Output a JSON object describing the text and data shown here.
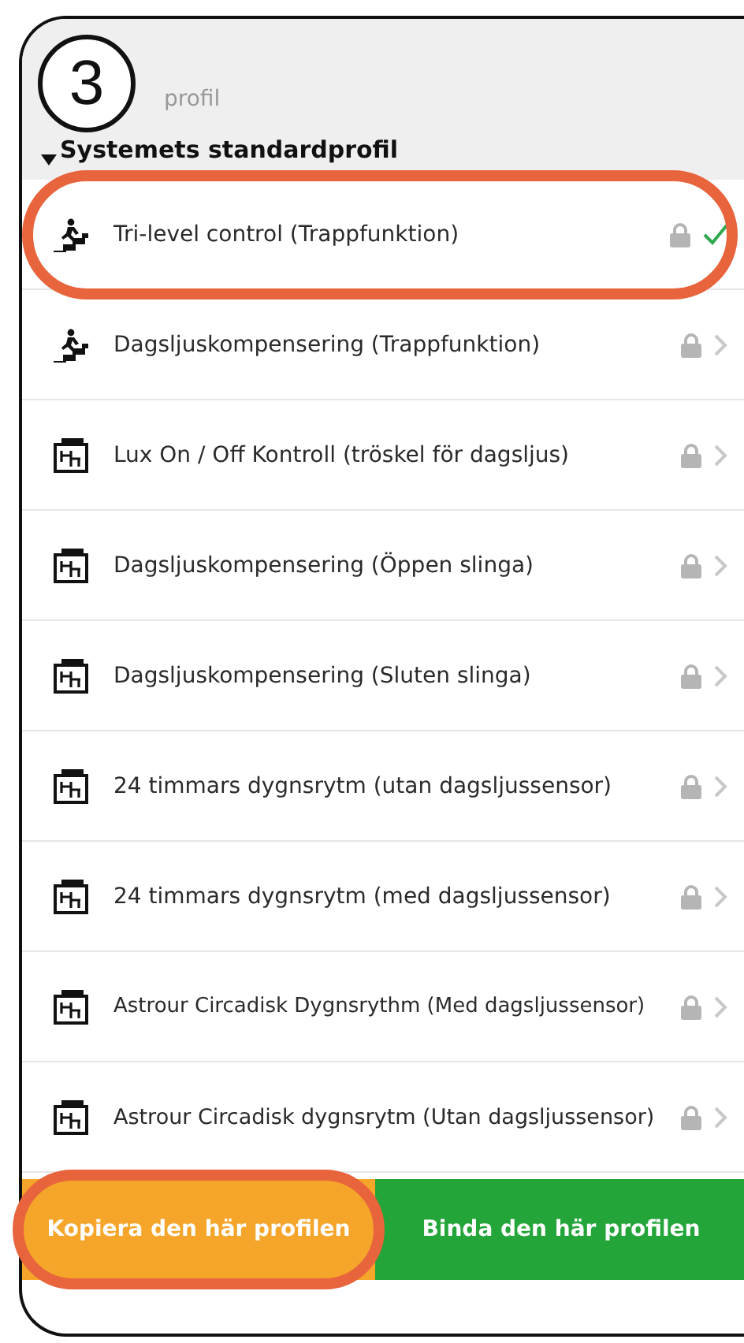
{
  "step_badge": "3",
  "header": {
    "title": "profil"
  },
  "group": {
    "label": "Systemets standardprofil",
    "expanded": true,
    "items": [
      {
        "kind": "stairs",
        "label": "Tri-level control (Trappfunktion)",
        "locked": true,
        "selected": true,
        "highlighted": true
      },
      {
        "kind": "stairs",
        "label": "Dagsljuskompensering (Trappfunktion)",
        "locked": true,
        "selected": false,
        "highlighted": false
      },
      {
        "kind": "panel",
        "label": "Lux On / Off Kontroll (tröskel för dagsljus)",
        "locked": true,
        "selected": false,
        "highlighted": false
      },
      {
        "kind": "panel",
        "label": "Dagsljuskompensering (Öppen slinga)",
        "locked": true,
        "selected": false,
        "highlighted": false
      },
      {
        "kind": "panel",
        "label": "Dagsljuskompensering (Sluten slinga)",
        "locked": true,
        "selected": false,
        "highlighted": false
      },
      {
        "kind": "panel",
        "label": "24 timmars dygnsrytm (utan dagsljussensor)",
        "locked": true,
        "selected": false,
        "highlighted": false
      },
      {
        "kind": "panel",
        "label": "24 timmars dygnsrytm (med dagsljussensor)",
        "locked": true,
        "selected": false,
        "highlighted": false
      },
      {
        "kind": "panel",
        "label": "Astrour Circadisk Dygnsrythm (Med dagsljussensor)",
        "locked": true,
        "selected": false,
        "highlighted": false
      },
      {
        "kind": "panel",
        "label": "Astrour Circadisk dygnsrytm (Utan dagsljussensor)",
        "locked": true,
        "selected": false,
        "highlighted": false
      }
    ]
  },
  "buttons": [
    {
      "kind": "copy",
      "label": "Kopiera den här profilen",
      "highlighted": true
    },
    {
      "kind": "bind",
      "label": "Binda den här profilen",
      "highlighted": false
    }
  ]
}
